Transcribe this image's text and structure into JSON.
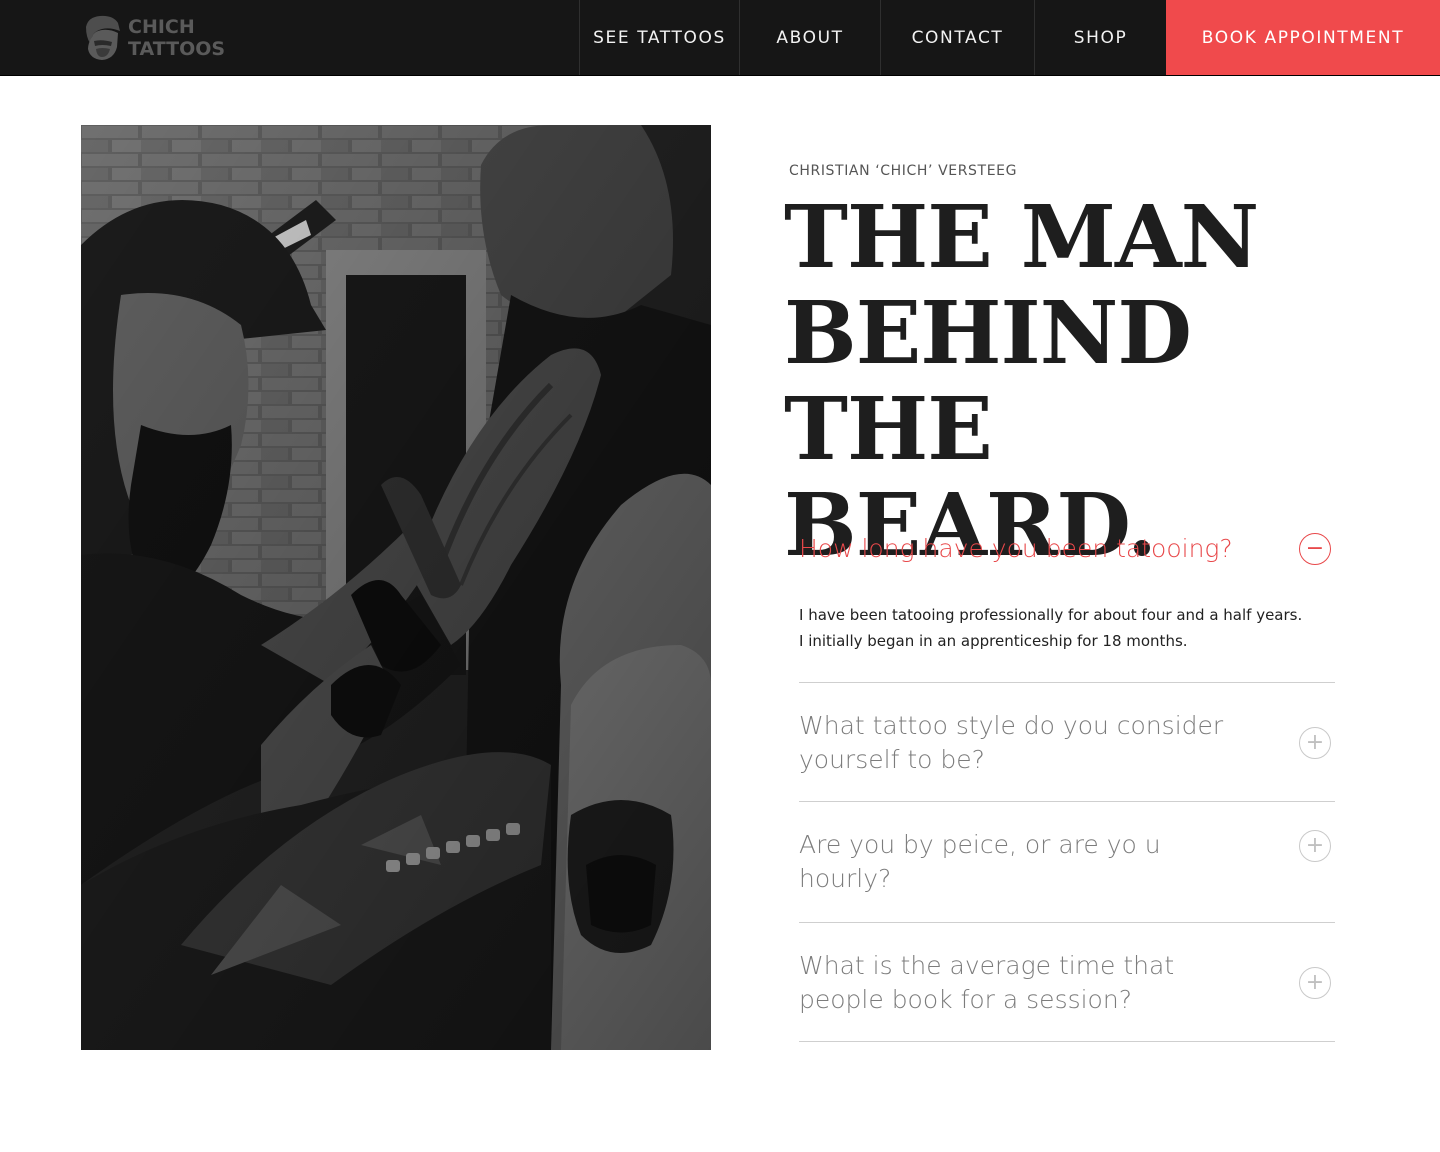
{
  "header": {
    "logo_line1": "CHICH",
    "logo_line2": "TATTOOS",
    "nav": [
      {
        "label": "SEE TATTOOS"
      },
      {
        "label": "ABOUT"
      },
      {
        "label": "CONTACT"
      },
      {
        "label": "SHOP"
      }
    ],
    "cta_label": "BOOK APPOINTMENT"
  },
  "hero": {
    "eyebrow": "CHRISTIAN ‘CHICH’ VERSTEEG",
    "headline_lines": [
      "THE MAN",
      "BEHIND THE",
      "BEARD."
    ]
  },
  "faq": [
    {
      "question": "How long have you been tatooing?",
      "expanded": true,
      "answer_lines": [
        "I have been tatooing professionally for about four and a half years.",
        "I initially began in an apprenticeship for 18 months."
      ]
    },
    {
      "question": "What tattoo style do you consider yourself to be?",
      "expanded": false
    },
    {
      "question": "Are you by peice, or are yo u hourly?",
      "expanded": false
    },
    {
      "question": "What is the average time that people book for a session?",
      "expanded": false
    }
  ],
  "icons": {
    "expanded": "minus-circle-icon",
    "collapsed": "plus-circle-icon",
    "logo": "bearded-head-icon"
  },
  "colors": {
    "header_bg": "#161616",
    "accent": "#f04a4c",
    "headline": "#1e1e1e"
  }
}
